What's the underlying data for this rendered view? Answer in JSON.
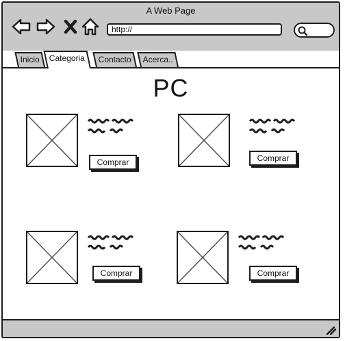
{
  "window": {
    "title": "A Web Page",
    "address": "http://"
  },
  "icons": {
    "back": "arrow-left-icon",
    "forward": "arrow-right-icon",
    "stop": "close-icon",
    "home": "home-icon",
    "search": "search-icon",
    "resize": "resize-grip-icon"
  },
  "tabs": [
    {
      "label": "Inicio"
    },
    {
      "label": "Categoria"
    },
    {
      "label": "Contacto"
    },
    {
      "label": "Acerca.."
    }
  ],
  "active_tab": "Categoria",
  "page": {
    "heading": "PC"
  },
  "products": [
    {
      "button_label": "Comprar"
    },
    {
      "button_label": "Comprar"
    },
    {
      "button_label": "Comprar"
    },
    {
      "button_label": "Comprar"
    }
  ],
  "colors": {
    "chrome": "#c8c8c8",
    "stroke": "#1e1e1e",
    "content": "#ffffff"
  }
}
